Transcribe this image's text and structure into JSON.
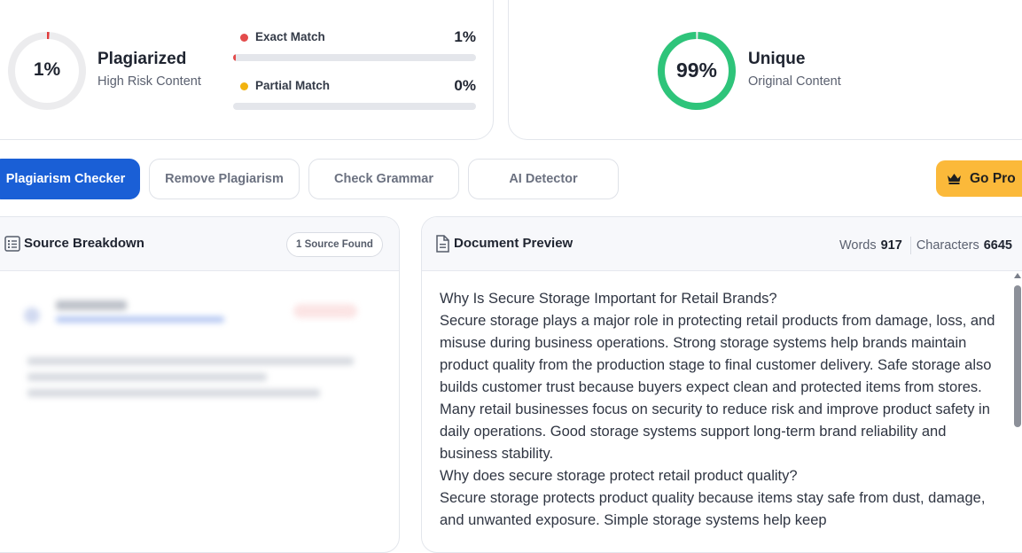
{
  "plagiarism": {
    "percent_label": "1%",
    "percent_value": 1,
    "title": "Plagiarized",
    "subtitle": "High Risk Content",
    "ring_color": "#e03b3b",
    "exact": {
      "label": "Exact Match",
      "percent_label": "1%",
      "value": 1,
      "dot_color": "#e34b4b"
    },
    "partial": {
      "label": "Partial Match",
      "percent_label": "0%",
      "value": 0,
      "dot_color": "#f2b30f"
    }
  },
  "unique": {
    "percent_label": "99%",
    "percent_value": 99,
    "title": "Unique",
    "subtitle": "Original Content",
    "ring_color": "#2ec47a"
  },
  "tabs": [
    {
      "label": "Plagiarism Checker",
      "active": true
    },
    {
      "label": "Remove Plagiarism",
      "active": false
    },
    {
      "label": "Check Grammar",
      "active": false
    },
    {
      "label": "AI Detector",
      "active": false
    }
  ],
  "go_pro": {
    "label": "Go Pro",
    "icon": "crown-icon"
  },
  "source_panel": {
    "title": "Source Breakdown",
    "badge": "1 Source Found",
    "icon": "list-icon"
  },
  "doc_panel": {
    "title": "Document Preview",
    "icon": "document-icon",
    "words_label": "Words",
    "words_value": "917",
    "chars_label": "Characters",
    "chars_value": "6645",
    "lines": [
      "Why Is Secure Storage Important for Retail Brands?",
      "Secure storage plays a major role in protecting retail products from damage, loss, and misuse during business operations. Strong storage systems help brands maintain product quality from the production stage to final customer delivery. Safe storage also builds customer trust because buyers expect clean and protected items from stores. Many retail businesses focus on security to reduce risk and improve product safety in daily operations. Good storage systems support long-term brand reliability and business stability.",
      "Why does secure storage protect retail product quality?",
      "Secure storage protects product quality because items stay safe from dust, damage, and unwanted exposure. Simple storage systems help keep"
    ]
  }
}
